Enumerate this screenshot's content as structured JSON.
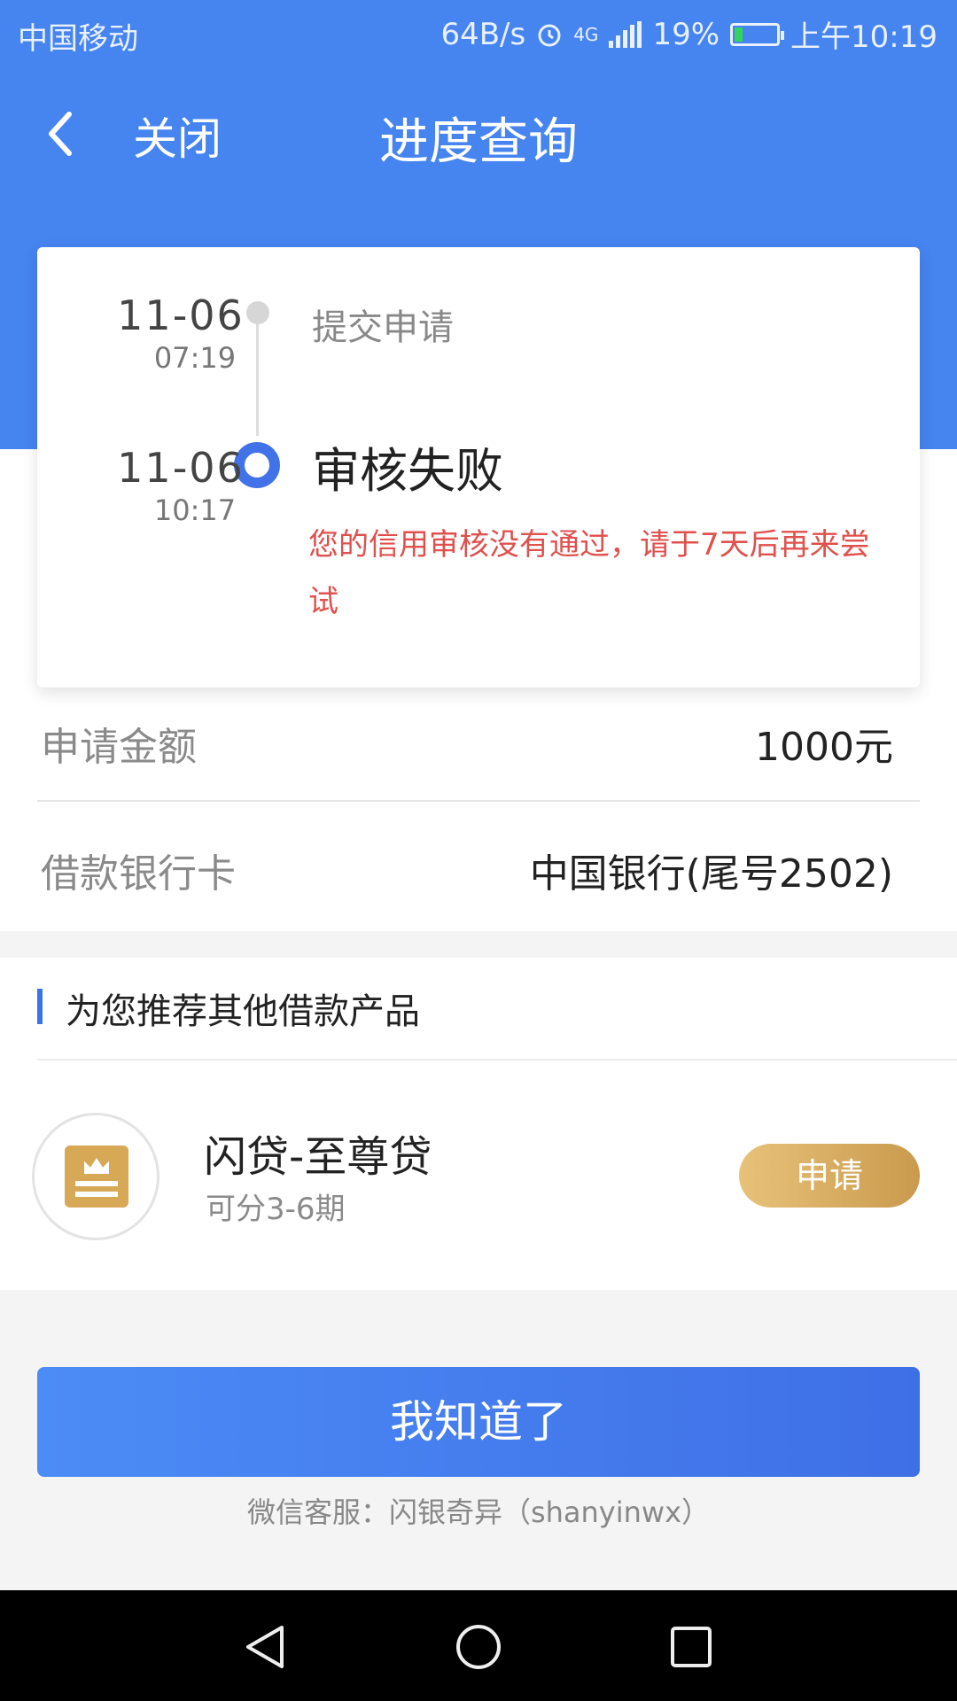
{
  "status_bar": {
    "carrier": "中国移动",
    "speed": "64B/s",
    "network": "4G",
    "battery": "19%",
    "battery_level": 0.19,
    "time": "上午10:19",
    "icons": [
      "alarm-icon",
      "signal-icon",
      "battery-icon"
    ]
  },
  "nav": {
    "close_label": "关闭",
    "title": "进度查询"
  },
  "progress": {
    "steps": [
      {
        "date": "11-06",
        "time": "07:19",
        "label": "提交申请"
      },
      {
        "date": "11-06",
        "time": "10:17",
        "label": "审核失败",
        "message": "您的信用审核没有通过，请于7天后再来尝试"
      }
    ]
  },
  "details": [
    {
      "label": "申请金额",
      "value": "1000元"
    },
    {
      "label": "借款银行卡",
      "value": "中国银行(尾号2502)"
    }
  ],
  "recommend": {
    "heading": "为您推荐其他借款产品",
    "product": {
      "name": "闪贷-至尊贷",
      "subtitle": "可分3-6期",
      "apply_label": "申请",
      "logo_icon": "crown-badge-icon"
    }
  },
  "confirm_label": "我知道了",
  "wechat_service": "微信客服：闪银奇异（shanyinwx）",
  "colors": {
    "primary": "#4684f0",
    "error": "#e0504c",
    "gold": "#d7a856"
  }
}
